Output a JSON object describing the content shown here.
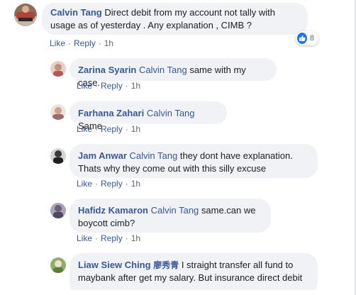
{
  "comments": [
    {
      "author": "Calvin Tang",
      "text": "Direct debit from my account not tally with usage as of yesterday . Any explanation , CIMB ?",
      "actions": {
        "like": "Like",
        "reply": "Reply",
        "time": "1h"
      },
      "reactions": {
        "count": "8",
        "icon": "like-icon"
      }
    },
    {
      "author": "Zarina Syarin",
      "mention": "Calvin Tang",
      "text": " same with my case.",
      "actions": {
        "like": "Like",
        "reply": "Reply",
        "time": "1h"
      }
    },
    {
      "author": "Farhana Zahari",
      "mention": "Calvin Tang",
      "text": " Same",
      "actions": {
        "like": "Like",
        "reply": "Reply",
        "time": "1h"
      }
    },
    {
      "author": "Jam Anwar",
      "mention": "Calvin Tang",
      "text": " they dont have explanation. Thats why they come out with this silly excuse",
      "actions": {
        "like": "Like",
        "reply": "Reply",
        "time": "1h"
      }
    },
    {
      "author": "Hafidz Kamaron",
      "mention": "Calvin Tang",
      "text": " same.can we boycott cimb?",
      "actions": {
        "like": "Like",
        "reply": "Reply",
        "time": "1h"
      }
    },
    {
      "author": "Liaw Siew Ching",
      "author_cn": "廖秀青",
      "text": " I straight transfer all fund to maybank after get my salary. But insurance direct debit"
    }
  ],
  "colors": {
    "link": "#385898",
    "bubble": "#f0f2f5",
    "text": "#1c1e21",
    "meta": "#606770",
    "like": "#1877f2"
  }
}
